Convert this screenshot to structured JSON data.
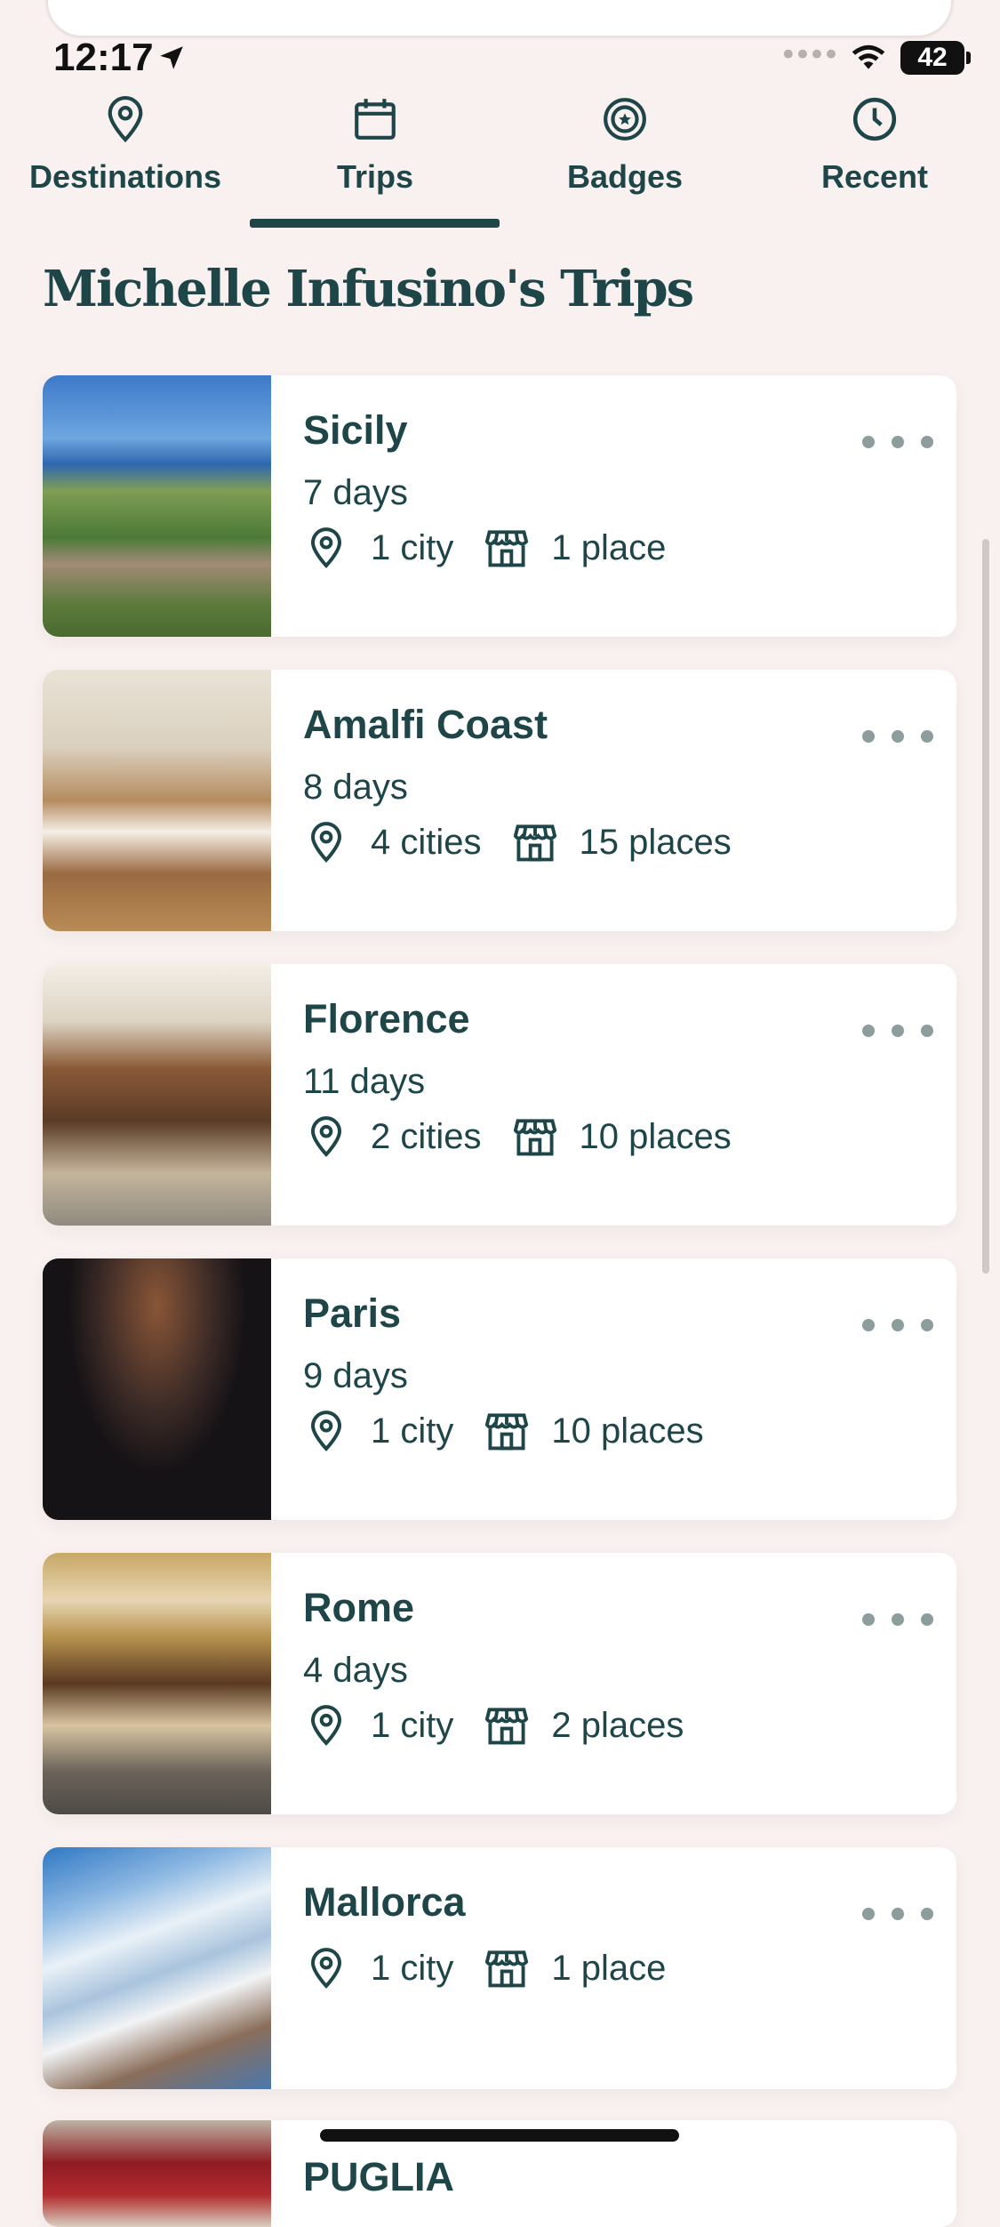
{
  "status_bar": {
    "time": "12:17",
    "battery": "42",
    "location_icon": "location-arrow-icon",
    "signal_icon": "cellular-dots-icon",
    "wifi_icon": "wifi-icon"
  },
  "tabs": [
    {
      "label": "Destinations",
      "icon": "map-pin-icon",
      "active": false
    },
    {
      "label": "Trips",
      "icon": "calendar-icon",
      "active": true
    },
    {
      "label": "Badges",
      "icon": "badge-icon",
      "active": false
    },
    {
      "label": "Recent",
      "icon": "clock-icon",
      "active": false
    }
  ],
  "page": {
    "title": "Michelle Infusino's Trips"
  },
  "trips": [
    {
      "name": "Sicily",
      "days": "7 days",
      "cities": "1 city",
      "places": "1 place"
    },
    {
      "name": "Amalfi Coast",
      "days": "8 days",
      "cities": "4 cities",
      "places": "15 places"
    },
    {
      "name": "Florence",
      "days": "11 days",
      "cities": "2 cities",
      "places": "10 places"
    },
    {
      "name": "Paris",
      "days": "9 days",
      "cities": "1 city",
      "places": "10 places"
    },
    {
      "name": "Rome",
      "days": "4 days",
      "cities": "1 city",
      "places": "2 places"
    },
    {
      "name": "Mallorca",
      "days": "",
      "cities": "1 city",
      "places": "1 place"
    },
    {
      "name": "PUGLIA"
    }
  ],
  "colors": {
    "primary": "#1e4548",
    "background": "#f8f1ef",
    "card": "#ffffff",
    "more_dots": "#8d9c9d"
  }
}
